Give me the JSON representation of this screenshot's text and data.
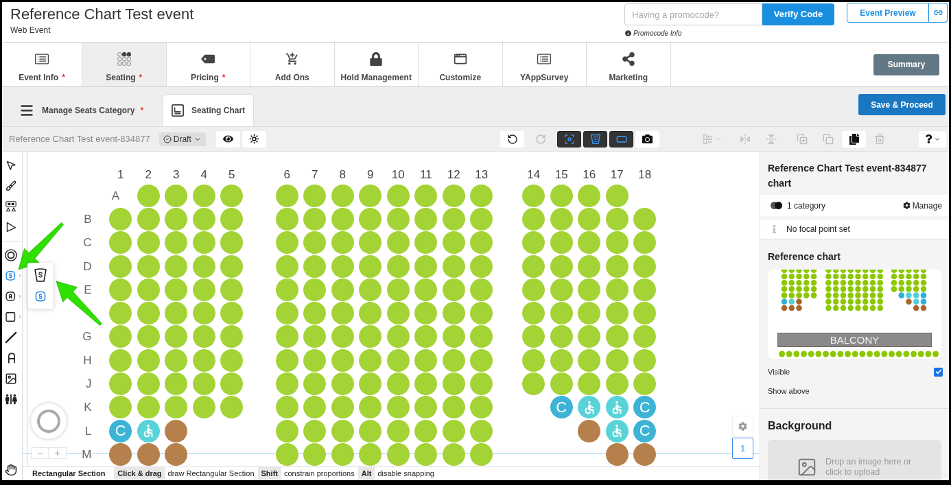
{
  "header": {
    "title": "Reference Chart Test event",
    "subtitle": "Web Event",
    "promocode": {
      "placeholder": "Having a promocode?",
      "button": "Verify Code",
      "info": "Promocode Info"
    },
    "preview_button": "Event Preview"
  },
  "main_tabs": [
    {
      "label": "Event Info",
      "mark": "*",
      "selected": false
    },
    {
      "label": "Seating",
      "mark": "*",
      "selected": true
    },
    {
      "label": "Pricing",
      "mark": "*",
      "selected": false
    },
    {
      "label": "Add Ons",
      "selected": false
    },
    {
      "label": "Hold Management",
      "selected": false
    },
    {
      "label": "Customize",
      "selected": false
    },
    {
      "label": "YAppSurvey",
      "selected": false
    },
    {
      "label": "Marketing",
      "selected": false
    }
  ],
  "summary_button": "Summary",
  "sub_tabs": [
    {
      "label": "Manage Seats Category",
      "mark": "*",
      "selected": false
    },
    {
      "label": "Seating Chart",
      "selected": true
    }
  ],
  "save_button": "Save & Proceed",
  "toolbar": {
    "chart_name": "Reference Chart Test event-834877",
    "status": "Draft",
    "history_buttons": [
      {
        "disabled": false
      },
      {
        "disabled": true
      }
    ],
    "layer_toggles": [
      {
        "on": true
      },
      {
        "on": true
      },
      {
        "on": true
      }
    ],
    "edit_buttons": [
      {
        "disabled": true
      },
      {
        "disabled": true
      },
      {
        "disabled": true
      },
      {
        "disabled": true
      },
      {
        "disabled": true
      },
      {
        "disabled": false
      },
      {
        "disabled": true
      }
    ]
  },
  "tools": {
    "select": [
      {
        "selected": false
      },
      {
        "selected": false
      },
      {
        "selected": false
      },
      {
        "selected": false
      }
    ],
    "draw": [
      {
        "selected": false,
        "submenu": false
      },
      {
        "selected": true,
        "submenu": true
      },
      {
        "selected": false,
        "submenu": true
      },
      {
        "selected": false,
        "submenu": true
      },
      {
        "selected": false,
        "submenu": false
      },
      {
        "selected": false,
        "submenu": false
      },
      {
        "selected": false,
        "submenu": false
      },
      {
        "selected": false,
        "submenu": false
      }
    ],
    "navigate": [
      {
        "selected": false
      }
    ]
  },
  "tool_flyout": [
    {
      "selected": false
    },
    {
      "selected": true
    }
  ],
  "seat_chart": {
    "columns": [
      "1",
      "2",
      "3",
      "4",
      "5",
      "6",
      "7",
      "8",
      "9",
      "10",
      "11",
      "12",
      "13",
      "14",
      "15",
      "16",
      "17",
      "18"
    ],
    "page": "1",
    "rows": [
      {
        "label": "A",
        "seats": [
          {
            "kind": "gap"
          },
          {
            "kind": "standard"
          },
          {
            "kind": "standard"
          },
          {
            "kind": "standard"
          },
          {
            "kind": "standard"
          },
          {
            "kind": "standard"
          },
          {
            "kind": "standard"
          },
          {
            "kind": "standard"
          },
          {
            "kind": "standard"
          },
          {
            "kind": "standard"
          },
          {
            "kind": "standard"
          },
          {
            "kind": "standard"
          },
          {
            "kind": "standard"
          },
          {
            "kind": "standard"
          },
          {
            "kind": "standard"
          },
          {
            "kind": "standard"
          },
          {
            "kind": "standard"
          },
          {
            "kind": "gap"
          }
        ]
      },
      {
        "label": "B",
        "seats": [
          {
            "kind": "standard"
          },
          {
            "kind": "standard"
          },
          {
            "kind": "standard"
          },
          {
            "kind": "standard"
          },
          {
            "kind": "standard"
          },
          {
            "kind": "standard"
          },
          {
            "kind": "standard"
          },
          {
            "kind": "standard"
          },
          {
            "kind": "standard"
          },
          {
            "kind": "standard"
          },
          {
            "kind": "standard"
          },
          {
            "kind": "standard"
          },
          {
            "kind": "standard"
          },
          {
            "kind": "standard"
          },
          {
            "kind": "standard"
          },
          {
            "kind": "standard"
          },
          {
            "kind": "standard"
          },
          {
            "kind": "standard"
          }
        ]
      },
      {
        "label": "C",
        "seats": [
          {
            "kind": "standard"
          },
          {
            "kind": "standard"
          },
          {
            "kind": "standard"
          },
          {
            "kind": "standard"
          },
          {
            "kind": "standard"
          },
          {
            "kind": "standard"
          },
          {
            "kind": "standard"
          },
          {
            "kind": "standard"
          },
          {
            "kind": "standard"
          },
          {
            "kind": "standard"
          },
          {
            "kind": "standard"
          },
          {
            "kind": "standard"
          },
          {
            "kind": "standard"
          },
          {
            "kind": "standard"
          },
          {
            "kind": "standard"
          },
          {
            "kind": "standard"
          },
          {
            "kind": "standard"
          },
          {
            "kind": "standard"
          }
        ]
      },
      {
        "label": "D",
        "seats": [
          {
            "kind": "standard"
          },
          {
            "kind": "standard"
          },
          {
            "kind": "standard"
          },
          {
            "kind": "standard"
          },
          {
            "kind": "standard"
          },
          {
            "kind": "standard"
          },
          {
            "kind": "standard"
          },
          {
            "kind": "standard"
          },
          {
            "kind": "standard"
          },
          {
            "kind": "standard"
          },
          {
            "kind": "standard"
          },
          {
            "kind": "standard"
          },
          {
            "kind": "standard"
          },
          {
            "kind": "standard"
          },
          {
            "kind": "standard"
          },
          {
            "kind": "standard"
          },
          {
            "kind": "standard"
          },
          {
            "kind": "standard"
          }
        ]
      },
      {
        "label": "E",
        "seats": [
          {
            "kind": "standard"
          },
          {
            "kind": "standard"
          },
          {
            "kind": "standard"
          },
          {
            "kind": "standard"
          },
          {
            "kind": "standard"
          },
          {
            "kind": "standard"
          },
          {
            "kind": "standard"
          },
          {
            "kind": "standard"
          },
          {
            "kind": "standard"
          },
          {
            "kind": "standard"
          },
          {
            "kind": "standard"
          },
          {
            "kind": "standard"
          },
          {
            "kind": "standard"
          },
          {
            "kind": "standard"
          },
          {
            "kind": "standard"
          },
          {
            "kind": "standard"
          },
          {
            "kind": "standard"
          },
          {
            "kind": "standard"
          }
        ]
      },
      {
        "seats": [
          {
            "kind": "standard"
          },
          {
            "kind": "standard"
          },
          {
            "kind": "standard"
          },
          {
            "kind": "standard"
          },
          {
            "kind": "standard"
          },
          {
            "kind": "standard"
          },
          {
            "kind": "standard"
          },
          {
            "kind": "standard"
          },
          {
            "kind": "standard"
          },
          {
            "kind": "standard"
          },
          {
            "kind": "standard"
          },
          {
            "kind": "standard"
          },
          {
            "kind": "standard"
          },
          {
            "kind": "standard"
          },
          {
            "kind": "standard"
          },
          {
            "kind": "standard"
          },
          {
            "kind": "standard"
          },
          {
            "kind": "standard"
          }
        ]
      },
      {
        "label": "G",
        "seats": [
          {
            "kind": "standard"
          },
          {
            "kind": "standard"
          },
          {
            "kind": "standard"
          },
          {
            "kind": "standard"
          },
          {
            "kind": "standard"
          },
          {
            "kind": "standard"
          },
          {
            "kind": "standard"
          },
          {
            "kind": "standard"
          },
          {
            "kind": "standard"
          },
          {
            "kind": "standard"
          },
          {
            "kind": "standard"
          },
          {
            "kind": "standard"
          },
          {
            "kind": "standard"
          },
          {
            "kind": "standard"
          },
          {
            "kind": "standard"
          },
          {
            "kind": "standard"
          },
          {
            "kind": "standard"
          },
          {
            "kind": "standard"
          }
        ]
      },
      {
        "label": "H",
        "seats": [
          {
            "kind": "standard"
          },
          {
            "kind": "standard"
          },
          {
            "kind": "standard"
          },
          {
            "kind": "standard"
          },
          {
            "kind": "standard"
          },
          {
            "kind": "standard"
          },
          {
            "kind": "standard"
          },
          {
            "kind": "standard"
          },
          {
            "kind": "standard"
          },
          {
            "kind": "standard"
          },
          {
            "kind": "standard"
          },
          {
            "kind": "standard"
          },
          {
            "kind": "standard"
          },
          {
            "kind": "standard"
          },
          {
            "kind": "standard"
          },
          {
            "kind": "standard"
          },
          {
            "kind": "standard"
          },
          {
            "kind": "standard"
          }
        ]
      },
      {
        "label": "J",
        "seats": [
          {
            "kind": "standard"
          },
          {
            "kind": "standard"
          },
          {
            "kind": "standard"
          },
          {
            "kind": "standard"
          },
          {
            "kind": "standard"
          },
          {
            "kind": "standard"
          },
          {
            "kind": "standard"
          },
          {
            "kind": "standard"
          },
          {
            "kind": "standard"
          },
          {
            "kind": "standard"
          },
          {
            "kind": "standard"
          },
          {
            "kind": "standard"
          },
          {
            "kind": "standard"
          },
          {
            "kind": "standard"
          },
          {
            "kind": "standard"
          },
          {
            "kind": "standard"
          },
          {
            "kind": "standard"
          },
          {
            "kind": "standard"
          }
        ]
      },
      {
        "label": "K",
        "seats": [
          {
            "kind": "standard"
          },
          {
            "kind": "standard"
          },
          {
            "kind": "standard"
          },
          {
            "kind": "standard"
          },
          {
            "kind": "standard"
          },
          {
            "kind": "standard"
          },
          {
            "kind": "standard"
          },
          {
            "kind": "standard"
          },
          {
            "kind": "standard"
          },
          {
            "kind": "standard"
          },
          {
            "kind": "standard"
          },
          {
            "kind": "standard"
          },
          {
            "kind": "standard"
          },
          {
            "kind": "gap"
          },
          {
            "kind": "companion",
            "label": "C"
          },
          {
            "kind": "wheelchair"
          },
          {
            "kind": "wheelchair"
          },
          {
            "kind": "companion",
            "label": "C"
          }
        ]
      },
      {
        "label": "L",
        "seats": [
          {
            "kind": "companion",
            "label": "C"
          },
          {
            "kind": "wheelchair"
          },
          {
            "kind": "special"
          },
          {
            "kind": "gap"
          },
          {
            "kind": "gap"
          },
          {
            "kind": "standard"
          },
          {
            "kind": "standard"
          },
          {
            "kind": "standard"
          },
          {
            "kind": "standard"
          },
          {
            "kind": "standard"
          },
          {
            "kind": "standard"
          },
          {
            "kind": "standard"
          },
          {
            "kind": "standard"
          },
          {
            "kind": "gap"
          },
          {
            "kind": "gap"
          },
          {
            "kind": "special"
          },
          {
            "kind": "wheelchair"
          },
          {
            "kind": "companion",
            "label": "C"
          }
        ]
      },
      {
        "label": "M",
        "seats": [
          {
            "kind": "special"
          },
          {
            "kind": "special"
          },
          {
            "kind": "special"
          },
          {
            "kind": "gap"
          },
          {
            "kind": "gap"
          },
          {
            "kind": "standard"
          },
          {
            "kind": "standard"
          },
          {
            "kind": "standard"
          },
          {
            "kind": "standard"
          },
          {
            "kind": "standard"
          },
          {
            "kind": "standard"
          },
          {
            "kind": "standard"
          },
          {
            "kind": "standard"
          },
          {
            "kind": "gap"
          },
          {
            "kind": "gap"
          },
          {
            "kind": "gap"
          },
          {
            "kind": "special"
          },
          {
            "kind": "special"
          }
        ]
      }
    ]
  },
  "status_bar": {
    "tool": "Rectangular Section",
    "hints": [
      {
        "key": "Click & drag",
        "action": "draw Rectangular Section"
      },
      {
        "key": "Shift",
        "action": "constrain proportions"
      },
      {
        "key": "Alt",
        "action": "disable snapping"
      }
    ]
  },
  "inspector": {
    "title": "Reference Chart Test event-834877 chart",
    "category_count": "1 category",
    "manage_button": "Manage",
    "focal_point": "No focal point set",
    "reference_chart": {
      "heading": "Reference chart",
      "section_label": "BALCONY",
      "visible_label": "Visible",
      "visible": true,
      "show_above_label": "Show above"
    },
    "background": {
      "heading": "Background",
      "dropzone": "Drop an image here or click to upload"
    }
  }
}
